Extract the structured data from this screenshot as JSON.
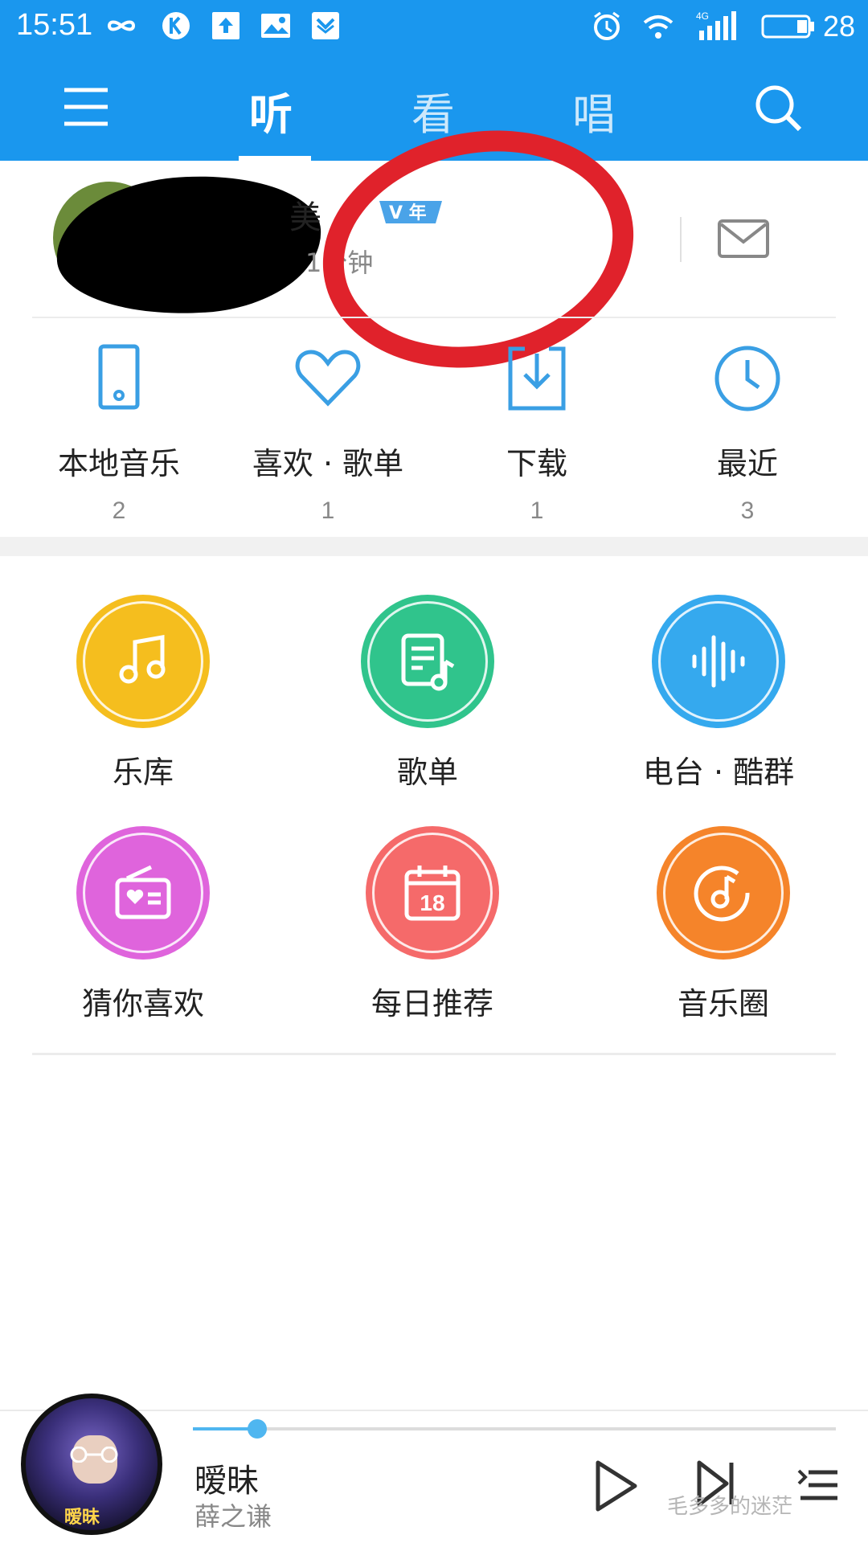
{
  "status_bar": {
    "time": "15:51",
    "network": "4G",
    "battery": "28",
    "left_icons": [
      "infinity-icon",
      "k-app-icon",
      "upload-icon",
      "gallery-icon",
      "shield-icon"
    ],
    "right_icons": [
      "alarm-icon",
      "wifi-icon",
      "signal-icon",
      "battery-icon"
    ]
  },
  "header": {
    "tabs": [
      {
        "label": "听",
        "active": true
      },
      {
        "label": "看",
        "active": false
      },
      {
        "label": "唱",
        "active": false
      }
    ],
    "accent": "#1a97ee"
  },
  "profile": {
    "name_visible": "美",
    "vip_badge": "V 年",
    "listen_text": "1分钟"
  },
  "quick_access": [
    {
      "label": "本地音乐",
      "count": "2",
      "icon": "tablet-icon"
    },
    {
      "label": "喜欢 · 歌单",
      "count": "1",
      "icon": "heart-icon"
    },
    {
      "label": "下载",
      "count": "1",
      "icon": "download-icon"
    },
    {
      "label": "最近",
      "count": "3",
      "icon": "clock-icon"
    }
  ],
  "grid": [
    {
      "label": "乐库",
      "icon": "music-note-icon",
      "color": "#f5be1e"
    },
    {
      "label": "歌单",
      "icon": "playlist-icon",
      "color": "#30c48c"
    },
    {
      "label": "电台 · 酷群",
      "icon": "soundwave-icon",
      "color": "#35a9ee"
    },
    {
      "label": "猜你喜欢",
      "icon": "radio-icon",
      "color": "#df64dc"
    },
    {
      "label": "每日推荐",
      "icon": "calendar-icon",
      "color": "#f56a6a",
      "calendar_day": "18"
    },
    {
      "label": "音乐圈",
      "icon": "disc-note-icon",
      "color": "#f5842a"
    }
  ],
  "player": {
    "song": "暧昧",
    "artist": "薛之谦",
    "progress": 0.1,
    "cover_text": "暧昧",
    "watermark": "毛多多的迷茫"
  }
}
